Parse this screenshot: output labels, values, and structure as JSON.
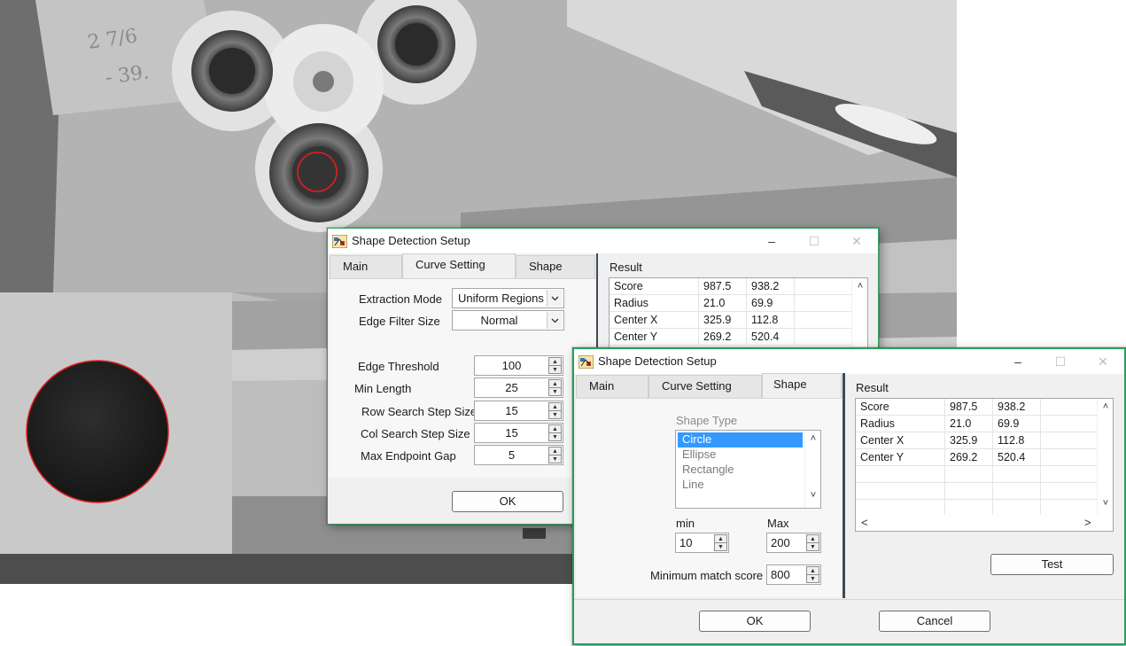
{
  "background_photo": {
    "description_icon": "fidget-spinner-camera-view",
    "detection_color": "#e02020"
  },
  "dialog_back": {
    "title": "Shape Detection Setup",
    "window_controls": {
      "minimize": "–",
      "maximize": "☐",
      "close": "✕"
    },
    "tabs": [
      "Main",
      "Curve Setting",
      "Shape"
    ],
    "active_tab": "Curve Setting",
    "fields": [
      {
        "label": "Extraction Mode",
        "value": "Uniform Regions"
      },
      {
        "label": "Edge Filter Size",
        "value": "Normal"
      },
      {
        "label": "Edge Threshold",
        "value": "100"
      },
      {
        "label": "Min Length",
        "value": "25"
      },
      {
        "label": "Row Search Step Size",
        "value": "15"
      },
      {
        "label": "Col Search Step Size",
        "value": "15"
      },
      {
        "label": "Max Endpoint Gap",
        "value": "5"
      }
    ],
    "ok_label": "OK",
    "result_label": "Result",
    "result_rows": [
      [
        "Score",
        "987.5",
        "938.2"
      ],
      [
        "Radius",
        "21.0",
        "69.9"
      ],
      [
        "Center X",
        "325.9",
        "112.8"
      ],
      [
        "Center Y",
        "269.2",
        "520.4"
      ]
    ]
  },
  "dialog_front": {
    "title": "Shape Detection Setup",
    "window_controls": {
      "minimize": "–",
      "maximize": "☐",
      "close": "✕"
    },
    "tabs": [
      "Main",
      "Curve Setting",
      "Shape"
    ],
    "active_tab": "Shape",
    "shape_type_label": "Shape Type",
    "shape_types": [
      "Circle",
      "Ellipse",
      "Rectangle",
      "Line"
    ],
    "selected_shape": "Circle",
    "min_label": "min",
    "min_value": "10",
    "max_label": "Max",
    "max_value": "200",
    "min_match_label": "Minimum match score",
    "min_match_value": "800",
    "result_label": "Result",
    "result_rows": [
      [
        "Score",
        "987.5",
        "938.2"
      ],
      [
        "Radius",
        "21.0",
        "69.9"
      ],
      [
        "Center X",
        "325.9",
        "112.8"
      ],
      [
        "Center Y",
        "269.2",
        "520.4"
      ]
    ],
    "test_label": "Test",
    "ok_label": "OK",
    "cancel_label": "Cancel"
  },
  "colors": {
    "dialog_border": "#2d9e5e",
    "selection": "#3399ff",
    "dialog_bg": "#f0f0f0"
  }
}
